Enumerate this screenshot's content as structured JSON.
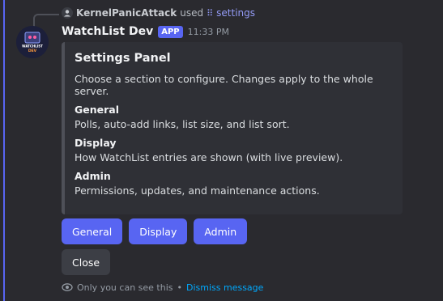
{
  "reply": {
    "username": "KernelPanicAttack",
    "action": "used",
    "command": "settings",
    "icon": "slash-command-icon"
  },
  "message": {
    "author": "WatchList Dev",
    "badge": "APP",
    "time": "11:33 PM",
    "avatar_text": [
      "WATCHLIST",
      "DEV"
    ]
  },
  "embed": {
    "title": "Settings Panel",
    "description": "Choose a section to configure. Changes apply to the whole server.",
    "fields": [
      {
        "name": "General",
        "value": "Polls, auto-add links, list size, and list sort."
      },
      {
        "name": "Display",
        "value": "How WatchList entries are shown (with live preview)."
      },
      {
        "name": "Admin",
        "value": "Permissions, updates, and maintenance actions."
      }
    ]
  },
  "buttons": {
    "general": "General",
    "display": "Display",
    "admin": "Admin",
    "close": "Close"
  },
  "ephemeral": {
    "note": "Only you can see this",
    "separator": "•",
    "dismiss": "Dismiss message"
  },
  "colors": {
    "accent": "#5865f2",
    "background": "#2a2a2f",
    "embed": "#2f3036",
    "link": "#00a8fc"
  }
}
